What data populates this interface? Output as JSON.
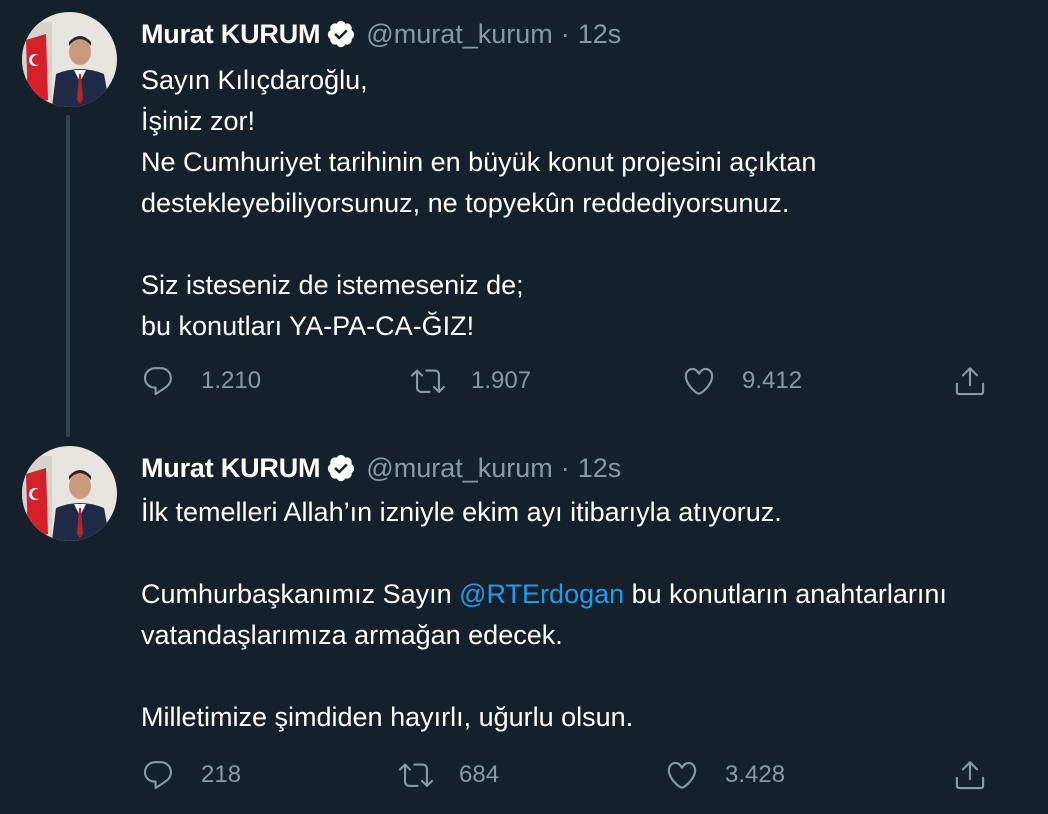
{
  "thread": {
    "tweets": [
      {
        "author_name": "Murat KURUM",
        "author_handle": "@murat_kurum",
        "separator": "·",
        "timestamp": "12s",
        "paragraphs": [
          "Sayın Kılıçdaroğlu,\nİşiniz zor!\nNe Cumhuriyet tarihinin en büyük konut projesini açıktan destekleyebiliyorsunuz, ne topyekûn reddediyorsunuz.",
          "Siz isteseniz de istemeseniz de;\nbu konutları YA-PA-CA-ĞIZ!"
        ],
        "replies": "1.210",
        "retweets": "1.907",
        "likes": "9.412"
      },
      {
        "author_name": "Murat KURUM",
        "author_handle": "@murat_kurum",
        "separator": "·",
        "timestamp": "12s",
        "p1": "İlk temelleri Allah’ın izniyle ekim ayı itibarıyla atıyoruz.",
        "p2_before": "Cumhurbaşkanımız Sayın ",
        "p2_mention": "@RTErdogan",
        "p2_after": " bu konutların anahtarlarını vatandaşlarımıza armağan edecek.",
        "p3": "Milletimize şimdiden hayırlı, uğurlu olsun.",
        "replies": "218",
        "retweets": "684",
        "likes": "3.428"
      }
    ]
  },
  "colors": {
    "background": "#15202b",
    "text_primary": "#ffffff",
    "text_secondary": "#8b98a5",
    "accent": "#1d9bf0",
    "thread_line": "#38444d"
  },
  "icons": {
    "verified": "verified-badge-icon",
    "reply": "reply-icon",
    "retweet": "retweet-icon",
    "like": "like-heart-icon",
    "share": "share-icon"
  }
}
